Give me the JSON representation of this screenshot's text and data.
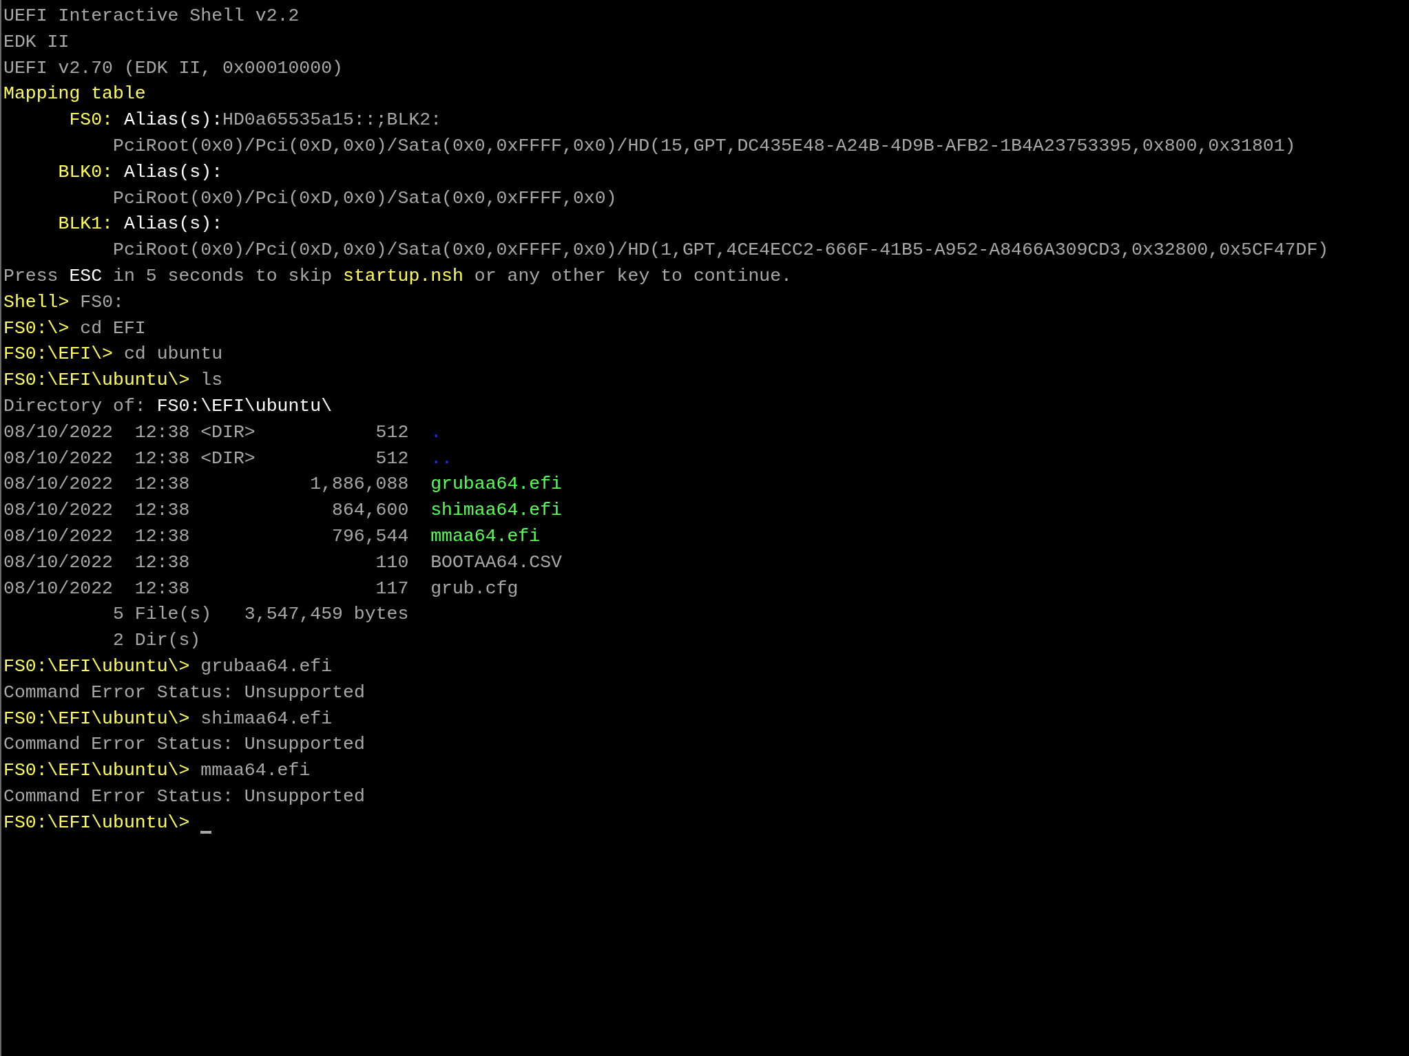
{
  "console": {
    "lines": [
      {
        "kind": "text",
        "segments": [
          {
            "kind": "output",
            "text": "UEFI Interactive Shell v2.2"
          }
        ]
      },
      {
        "kind": "text",
        "segments": [
          {
            "kind": "output",
            "text": "EDK II"
          }
        ]
      },
      {
        "kind": "text",
        "segments": [
          {
            "kind": "output",
            "text": "UEFI v2.70 (EDK II, 0x00010000)"
          }
        ]
      },
      {
        "kind": "text",
        "segments": [
          {
            "kind": "heading",
            "text": "Mapping table"
          }
        ]
      },
      {
        "kind": "mapping",
        "label": "FS0:",
        "segments": [
          {
            "kind": "keyword",
            "text": "Alias(s):"
          },
          {
            "kind": "output",
            "text": "HD0a65535a15::;BLK2:"
          }
        ]
      },
      {
        "kind": "device_path",
        "segments": [
          {
            "kind": "output",
            "text": "PciRoot(0x0)/Pci(0xD,0x0)/Sata(0x0,0xFFFF,0x0)/HD(15,GPT,DC435E48-A24B-4D9B-AFB2-1B4A23753395,0x800,0x31801)"
          }
        ]
      },
      {
        "kind": "mapping",
        "label": "BLK0:",
        "segments": [
          {
            "kind": "keyword",
            "text": "Alias(s):"
          }
        ]
      },
      {
        "kind": "device_path",
        "segments": [
          {
            "kind": "output",
            "text": "PciRoot(0x0)/Pci(0xD,0x0)/Sata(0x0,0xFFFF,0x0)"
          }
        ]
      },
      {
        "kind": "mapping",
        "label": "BLK1:",
        "segments": [
          {
            "kind": "keyword",
            "text": "Alias(s):"
          }
        ]
      },
      {
        "kind": "device_path",
        "segments": [
          {
            "kind": "output",
            "text": "PciRoot(0x0)/Pci(0xD,0x0)/Sata(0x0,0xFFFF,0x0)/HD(1,GPT,4CE4ECC2-666F-41B5-A952-A8466A309CD3,0x32800,0x5CF47DF)"
          }
        ]
      },
      {
        "kind": "text",
        "segments": [
          {
            "kind": "output",
            "text": "Press "
          },
          {
            "kind": "keyword",
            "text": "ESC"
          },
          {
            "kind": "output",
            "text": " in 5 seconds to skip "
          },
          {
            "kind": "heading",
            "text": "startup.nsh"
          },
          {
            "kind": "output",
            "text": " or any other key to continue."
          }
        ]
      },
      {
        "kind": "text",
        "segments": [
          {
            "kind": "prompt",
            "text": "Shell>"
          },
          {
            "kind": "command",
            "text": " FS0:"
          }
        ]
      },
      {
        "kind": "text",
        "segments": [
          {
            "kind": "prompt",
            "text": "FS0:\\>"
          },
          {
            "kind": "command",
            "text": " cd EFI"
          }
        ]
      },
      {
        "kind": "text",
        "segments": [
          {
            "kind": "prompt",
            "text": "FS0:\\EFI\\>"
          },
          {
            "kind": "command",
            "text": " cd ubuntu"
          }
        ]
      },
      {
        "kind": "text",
        "segments": [
          {
            "kind": "prompt",
            "text": "FS0:\\EFI\\ubuntu\\>"
          },
          {
            "kind": "command",
            "text": " ls"
          }
        ]
      },
      {
        "kind": "text",
        "segments": [
          {
            "kind": "output",
            "text": "Directory of: "
          },
          {
            "kind": "keyword",
            "text": "FS0:\\EFI\\ubuntu\\"
          }
        ]
      },
      {
        "kind": "entry",
        "date": "08/10/2022",
        "time": "12:38",
        "type": "<DIR>",
        "size": "512",
        "name": {
          "kind": "directory",
          "text": "."
        }
      },
      {
        "kind": "entry",
        "date": "08/10/2022",
        "time": "12:38",
        "type": "<DIR>",
        "size": "512",
        "name": {
          "kind": "directory",
          "text": ".."
        }
      },
      {
        "kind": "entry",
        "date": "08/10/2022",
        "time": "12:38",
        "size": "1,886,088",
        "name": {
          "kind": "executable",
          "text": "grubaa64.efi"
        }
      },
      {
        "kind": "entry",
        "date": "08/10/2022",
        "time": "12:38",
        "size": "864,600",
        "name": {
          "kind": "executable",
          "text": "shimaa64.efi"
        }
      },
      {
        "kind": "entry",
        "date": "08/10/2022",
        "time": "12:38",
        "size": "796,544",
        "name": {
          "kind": "executable",
          "text": "mmaa64.efi"
        }
      },
      {
        "kind": "entry",
        "date": "08/10/2022",
        "time": "12:38",
        "size": "110",
        "name": {
          "kind": "file",
          "text": "BOOTAA64.CSV"
        }
      },
      {
        "kind": "entry",
        "date": "08/10/2022",
        "time": "12:38",
        "size": "117",
        "name": {
          "kind": "file",
          "text": "grub.cfg"
        }
      },
      {
        "kind": "summary",
        "segments": [
          {
            "kind": "output",
            "text": "5 File(s)   3,547,459 bytes"
          }
        ]
      },
      {
        "kind": "summary",
        "segments": [
          {
            "kind": "output",
            "text": "2 Dir(s)"
          }
        ]
      },
      {
        "kind": "text",
        "segments": [
          {
            "kind": "prompt",
            "text": "FS0:\\EFI\\ubuntu\\>"
          },
          {
            "kind": "command",
            "text": " grubaa64.efi"
          }
        ]
      },
      {
        "kind": "text",
        "segments": [
          {
            "kind": "output",
            "text": "Command Error Status: Unsupported"
          }
        ]
      },
      {
        "kind": "text",
        "segments": [
          {
            "kind": "prompt",
            "text": "FS0:\\EFI\\ubuntu\\>"
          },
          {
            "kind": "command",
            "text": " shimaa64.efi"
          }
        ]
      },
      {
        "kind": "text",
        "segments": [
          {
            "kind": "output",
            "text": "Command Error Status: Unsupported"
          }
        ]
      },
      {
        "kind": "text",
        "segments": [
          {
            "kind": "prompt",
            "text": "FS0:\\EFI\\ubuntu\\>"
          },
          {
            "kind": "command",
            "text": " mmaa64.efi"
          }
        ]
      },
      {
        "kind": "text",
        "segments": [
          {
            "kind": "output",
            "text": "Command Error Status: Unsupported"
          }
        ]
      },
      {
        "kind": "text",
        "segments": [
          {
            "kind": "prompt",
            "text": "FS0:\\EFI\\ubuntu\\>"
          }
        ]
      }
    ]
  }
}
